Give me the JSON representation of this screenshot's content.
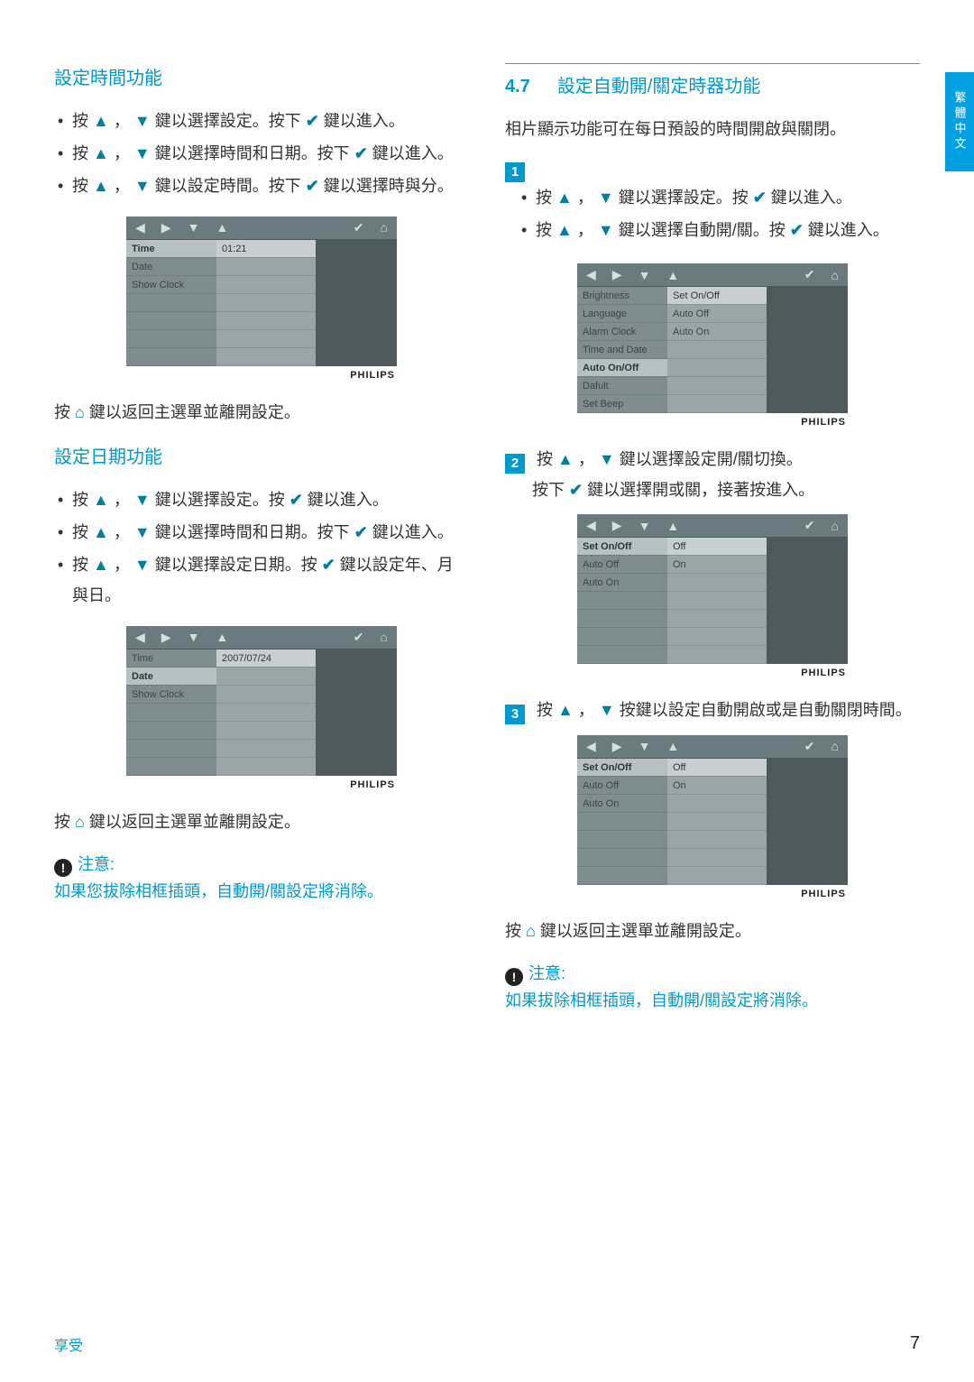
{
  "sideTab": "繁體中文",
  "footer": {
    "left": "享受",
    "page": "7"
  },
  "left": {
    "sec1": {
      "title": "設定時間功能",
      "b1a": "按 ",
      "b1b": " ， ",
      "b1c": " 鍵以選擇設定。按下 ",
      "b1d": " 鍵以進入。",
      "b2a": "按 ",
      "b2b": " ， ",
      "b2c": " 鍵以選擇時間和日期。按下 ",
      "b2d": " 鍵以進入。",
      "b3a": "按 ",
      "b3b": " ， ",
      "b3c": " 鍵以設定時間。按下 ",
      "b3d": " 鍵以選擇時與分。",
      "device": {
        "menu": [
          "Time",
          "Date",
          "Show Clock",
          "",
          "",
          "",
          ""
        ],
        "selIndex": 0,
        "values": [
          "01:21",
          "",
          "",
          "",
          "",
          "",
          ""
        ],
        "valSelIndex": 0,
        "brand": "PHILIPS"
      },
      "ret_a": "按 ",
      "ret_b": " 鍵以返回主選單並離開設定。"
    },
    "sec2": {
      "title": "設定日期功能",
      "b1a": "按 ",
      "b1b": " ， ",
      "b1c": " 鍵以選擇設定。按 ",
      "b1d": " 鍵以進入。",
      "b2a": "按 ",
      "b2b": " ， ",
      "b2c": " 鍵以選擇時間和日期。按下 ",
      "b2d": " 鍵以進入。",
      "b3a": "按 ",
      "b3b": " ， ",
      "b3c": " 鍵以選擇設定日期。按 ",
      "b3d": " 鍵以設定年、月與日。",
      "device": {
        "menu": [
          "Time",
          "Date",
          "Show Clock",
          "",
          "",
          "",
          ""
        ],
        "selIndex": 1,
        "values": [
          "2007/07/24",
          "",
          "",
          "",
          "",
          "",
          ""
        ],
        "valSelIndex": 0,
        "brand": "PHILIPS"
      },
      "ret_a": "按 ",
      "ret_b": " 鍵以返回主選單並離開設定。",
      "noteLabel": "注意:",
      "noteBody": "如果您拔除相框插頭，自動開/關設定將消除。"
    }
  },
  "right": {
    "secNum": "4.7",
    "title": "設定自動開/關定時器功能",
    "intro": "相片顯示功能可在每日預設的時間開啟與關閉。",
    "step1": {
      "num": "1",
      "b1a": "按 ",
      "b1b": " ， ",
      "b1c": " 鍵以選擇設定。按 ",
      "b1d": " 鍵以進入。",
      "b2a": "按 ",
      "b2b": " ， ",
      "b2c": " 鍵以選擇自動開/關。按 ",
      "b2d": " 鍵以進入。",
      "device": {
        "menu": [
          "Brightness",
          "Language",
          "Alarm Clock",
          "Time and Date",
          "Auto On/Off",
          "Dafult",
          "Set Beep"
        ],
        "selIndex": 4,
        "values": [
          "Set On/Off",
          "Auto Off",
          "Auto On",
          "",
          "",
          "",
          ""
        ],
        "valSelIndex": 0,
        "brand": "PHILIPS"
      }
    },
    "step2": {
      "num": "2",
      "l1a": "按 ",
      "l1b": " ， ",
      "l1c": " 鍵以選擇設定開/關切換。",
      "l2a": "按下 ",
      "l2b": " 鍵以選擇開或關，接著按進入。",
      "device": {
        "menu": [
          "Set On/Off",
          "Auto Off",
          "Auto On",
          "",
          "",
          "",
          ""
        ],
        "selIndex": 0,
        "values": [
          "Off",
          "On",
          "",
          "",
          "",
          "",
          ""
        ],
        "valSelIndex": 0,
        "brand": "PHILIPS"
      }
    },
    "step3": {
      "num": "3",
      "l1a": "按 ",
      "l1b": " ， ",
      "l1c": " 按鍵以設定自動開啟或是自動關閉時間。",
      "device": {
        "menu": [
          "Set On/Off",
          "Auto Off",
          "Auto On",
          "",
          "",
          "",
          ""
        ],
        "selIndex": 0,
        "values": [
          "Off",
          "On",
          "",
          "",
          "",
          "",
          ""
        ],
        "valSelIndex": 0,
        "brand": "PHILIPS"
      }
    },
    "ret_a": "按 ",
    "ret_b": " 鍵以返回主選單並離開設定。",
    "noteLabel": "注意:",
    "noteBody": "如果拔除相框插頭，自動開/關設定將消除。"
  }
}
